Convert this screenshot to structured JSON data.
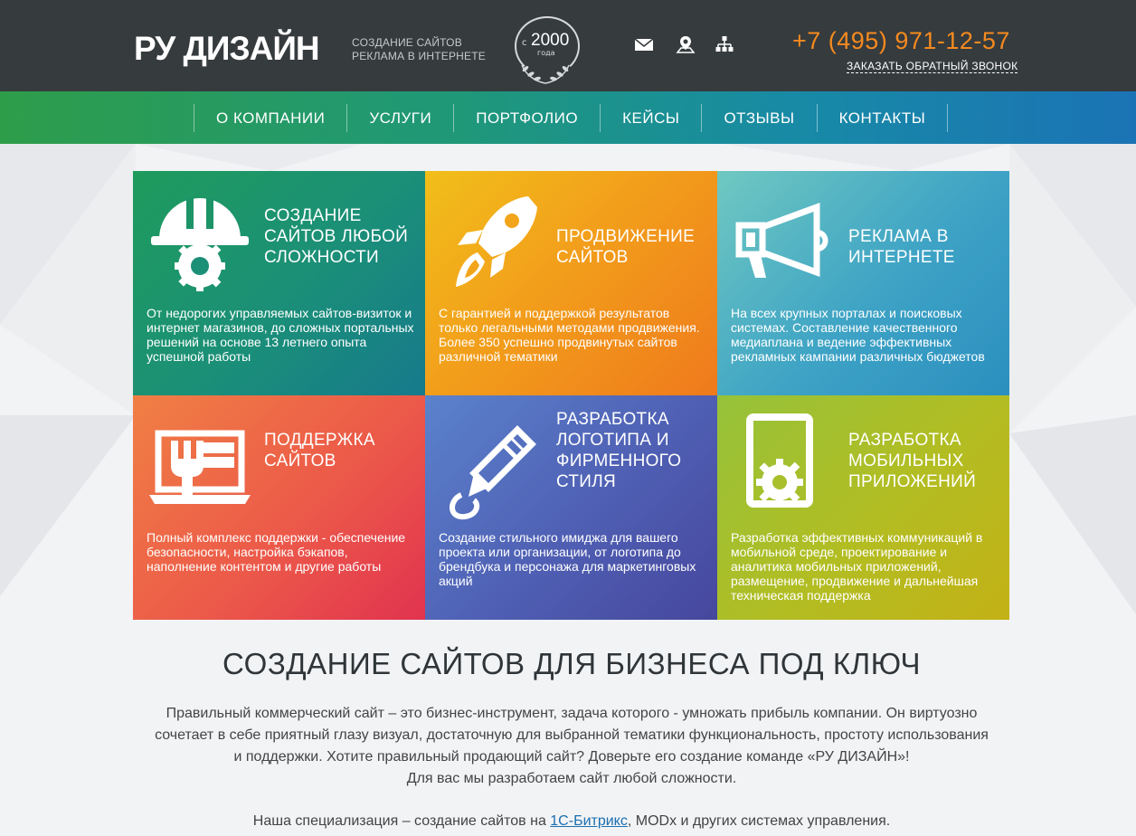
{
  "header": {
    "logo": "РУ ДИЗАЙН",
    "tagline_1": "СОЗДАНИЕ САЙТОВ",
    "tagline_2": "РЕКЛАМА В ИНТЕРНЕТЕ",
    "since_prefix": "с",
    "since_year": "2000",
    "since_suffix": "года",
    "phone": "+7 (495) 971-12-57",
    "callback": "ЗАКАЗАТЬ ОБРАТНЫЙ ЗВОНОК",
    "icons": [
      "mail-icon",
      "location-icon",
      "sitemap-icon"
    ]
  },
  "nav": {
    "items": [
      "О КОМПАНИИ",
      "УСЛУГИ",
      "ПОРТФОЛИО",
      "КЕЙСЫ",
      "ОТЗЫВЫ",
      "КОНТАКТЫ"
    ]
  },
  "tiles": [
    {
      "title_1": "СОЗДАНИЕ",
      "title_2": "САЙТОВ ЛЮБОЙ",
      "title_3": "СЛОЖНОСТИ",
      "desc": "От недорогих управляемых сайтов-визиток и интернет магазинов, до сложных портальных решений на основе 13 летнего опыта успешной работы",
      "icon": "helmet-gear-icon"
    },
    {
      "title_1": "ПРОДВИЖЕНИЕ",
      "title_2": "САЙТОВ",
      "desc": "С гарантией и поддержкой результатов только легальными методами продвижения. Более 350 успешно продвинутых сайтов различной тематики",
      "icon": "rocket-icon"
    },
    {
      "title_1": "РЕКЛАМА В",
      "title_2": "ИНТЕРНЕТЕ",
      "desc": "На всех крупных порталах и поисковых системах. Составление качественного медиаплана и ведение эффективных рекламных кампании различных бюджетов",
      "icon": "megaphone-icon"
    },
    {
      "title_1": "ПОДДЕРЖКА",
      "title_2": "САЙТОВ",
      "desc": "Полный комплекс поддержки - обеспечение безопасности, настройка бэкапов, наполнение контентом и другие работы",
      "icon": "laptop-wrench-icon"
    },
    {
      "title_1": "РАЗРАБОТКА",
      "title_2": "ЛОГОТИПА И",
      "title_3": "ФИРМЕННОГО",
      "title_4": "СТИЛЯ",
      "desc": "Создание стильного имиджа для вашего проекта или организации, от логотипа до брендбука и персонажа для маркетинговых акций",
      "icon": "pen-icon"
    },
    {
      "title_1": "РАЗРАБОТКА",
      "title_2": "МОБИЛЬНЫХ",
      "title_3": "ПРИЛОЖЕНИЙ",
      "desc": "Разработка эффективных коммуникаций в мобильной среде, проектирование и аналитика мобильных приложений, размещение, продвижение и дальнейшая техническая поддержка",
      "icon": "phone-gear-icon"
    }
  ],
  "main": {
    "heading": "СОЗДАНИЕ САЙТОВ ДЛЯ БИЗНЕСА ПОД КЛЮЧ",
    "para_1": "Правильный коммерческий сайт – это бизнес-инструмент, задача которого - умножать прибыль компании. Он виртуозно сочетает в себе приятный глазу визуал, достаточную для выбранной тематики функциональность, простоту использования и поддержки.  Хотите правильный продающий сайт? Доверьте его создание команде «РУ ДИЗАЙН»!",
    "para_2": "Для вас мы разработаем сайт любой сложности.",
    "spec_prefix": "Наша специализация – создание сайтов на ",
    "spec_link": "1С-Битрикс",
    "spec_suffix": ", MODx и других системах управления."
  },
  "colors": {
    "header_bg": "#363b3d",
    "phone": "#f58a1f",
    "link": "#1a6fb0"
  }
}
